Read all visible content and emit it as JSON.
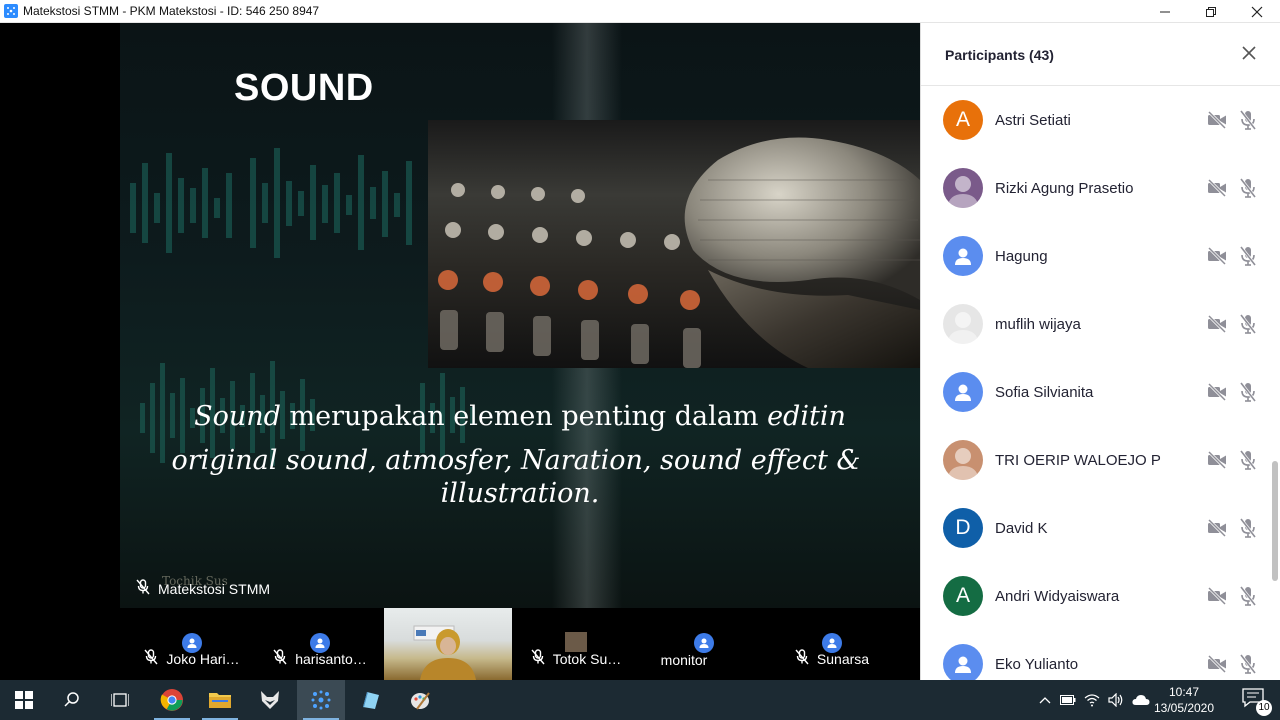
{
  "window": {
    "title": "Matekstosi STMM - PKM Matekstosi - ID: 546 250 8947",
    "minimize": "—",
    "maximize": "❐",
    "close": "✕"
  },
  "slide": {
    "title": "SOUND",
    "line1_italic_start": "Sound",
    "line1_regular": " merupakan elemen penting dalam ",
    "line1_italic_end": "editin",
    "line2": "original sound, atmosfer, Naration, sound effect &",
    "line3": "illustration."
  },
  "main_speaker": {
    "name": "Matekstosi STMM",
    "overlay_text": "Tochik Sus"
  },
  "thumbnails": [
    {
      "name": "Joko Hari…",
      "muted": true
    },
    {
      "name": "harisanto…",
      "muted": true
    },
    {
      "name": "",
      "video": true
    },
    {
      "name": "Totok Su…",
      "muted": true
    },
    {
      "name": "monitor",
      "muted": false
    },
    {
      "name": "Sunarsa",
      "muted": true
    }
  ],
  "participants": {
    "title": "Participants (43)",
    "list": [
      {
        "name": "Astri Setiati",
        "initial": "A",
        "color": "#e8710a",
        "type": "initial"
      },
      {
        "name": "Rizki Agung Prasetio",
        "initial": "",
        "color": "#7a5a8a",
        "type": "photo"
      },
      {
        "name": "Hagung",
        "initial": "",
        "color": "#5b8def",
        "type": "user"
      },
      {
        "name": "muflih wijaya",
        "initial": "",
        "color": "#e6e6e6",
        "type": "photo"
      },
      {
        "name": "Sofia Silvianita",
        "initial": "",
        "color": "#5b8def",
        "type": "user"
      },
      {
        "name": "TRI OERIP WALOEJO P",
        "initial": "",
        "color": "#c89070",
        "type": "photo"
      },
      {
        "name": "David K",
        "initial": "D",
        "color": "#0f5fa8",
        "type": "initial"
      },
      {
        "name": "Andri Widyaiswara",
        "initial": "A",
        "color": "#146c43",
        "type": "initial"
      },
      {
        "name": "Eko Yulianto",
        "initial": "",
        "color": "#5b8def",
        "type": "user"
      }
    ]
  },
  "taskbar": {
    "time": "10:47",
    "date": "13/05/2020",
    "notifications": "10"
  },
  "colors": {
    "accent": "#2d8cff",
    "taskbar": "#1c2a33"
  }
}
